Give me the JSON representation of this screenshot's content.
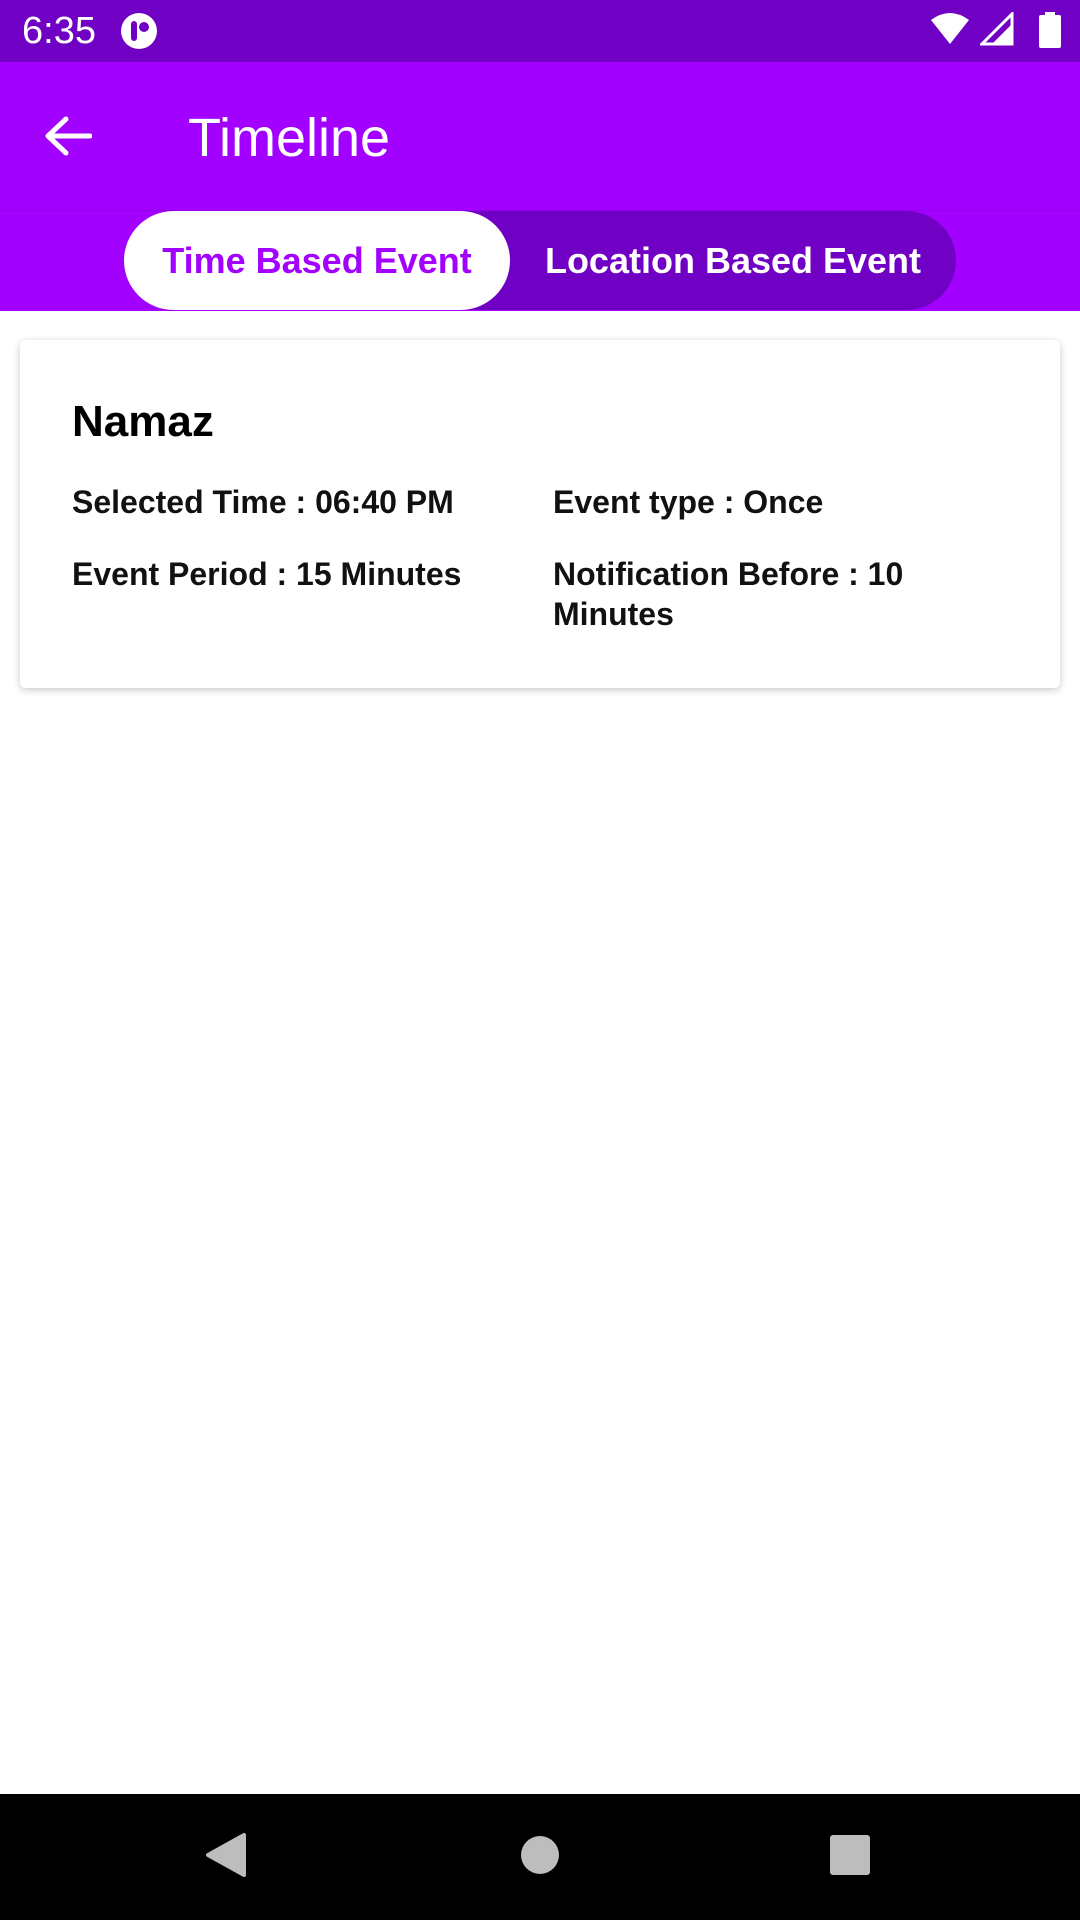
{
  "status_bar": {
    "time": "6:35"
  },
  "app_bar": {
    "title": "Timeline"
  },
  "tabs": [
    {
      "label": "Time Based Event",
      "active": true
    },
    {
      "label": "Location Based Event",
      "active": false
    }
  ],
  "event": {
    "title": "Namaz",
    "selected_time": "Selected Time : 06:40 PM",
    "event_type": "Event type : Once",
    "event_period": "Event Period : 15 Minutes",
    "notification_before": "Notification Before : 10 Minutes"
  },
  "colors": {
    "status_bar": "#7000c4",
    "primary": "#a200ff",
    "tab_pill": "#7000c4",
    "nav_bar": "#000000"
  },
  "icons": {
    "back": "arrow-left-icon",
    "app_status": "app-notification-icon",
    "wifi": "wifi-icon",
    "signal": "signal-icon",
    "battery": "battery-icon",
    "nav_back": "nav-back-icon",
    "nav_home": "nav-home-icon",
    "nav_recents": "nav-recents-icon"
  }
}
